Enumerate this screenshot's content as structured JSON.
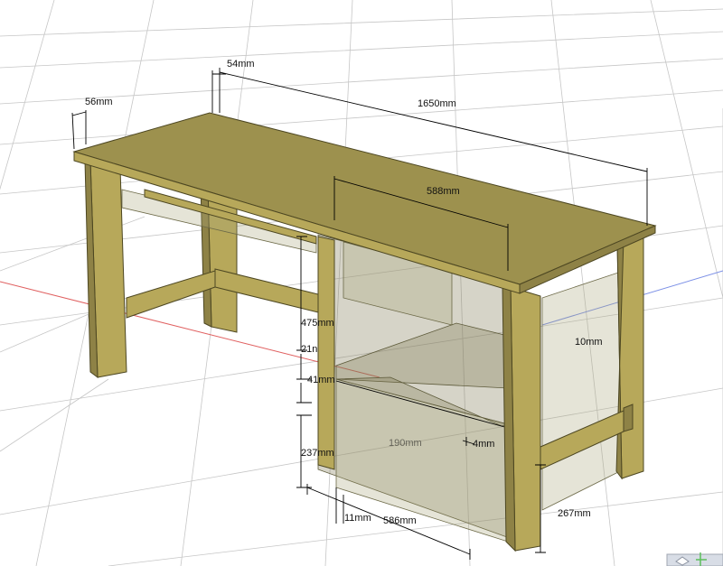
{
  "dimensions": {
    "top_depth": "54mm",
    "top_thickness": "56mm",
    "top_length": "1650mm",
    "drawer_width": "588mm",
    "side_height": "475mm",
    "dim_21": "21n",
    "dim_41": "41mm",
    "panel_10": "10mm",
    "drawer_inner_190": "190mm",
    "drawer_inner_4": "4mm",
    "dim_237": "237mm",
    "dim_11": "11mm",
    "dim_586": "586mm",
    "dim_267": "267mm"
  },
  "colors": {
    "wood": "#b7a85a",
    "wood_top": "#9d914e",
    "grid_line": "#c6c6c6",
    "axis_red": "#e06060",
    "axis_blue": "#7b8fe6",
    "axis_green": "#5cbf5c"
  },
  "icons": {
    "view_cube": "view-cube-icon"
  }
}
